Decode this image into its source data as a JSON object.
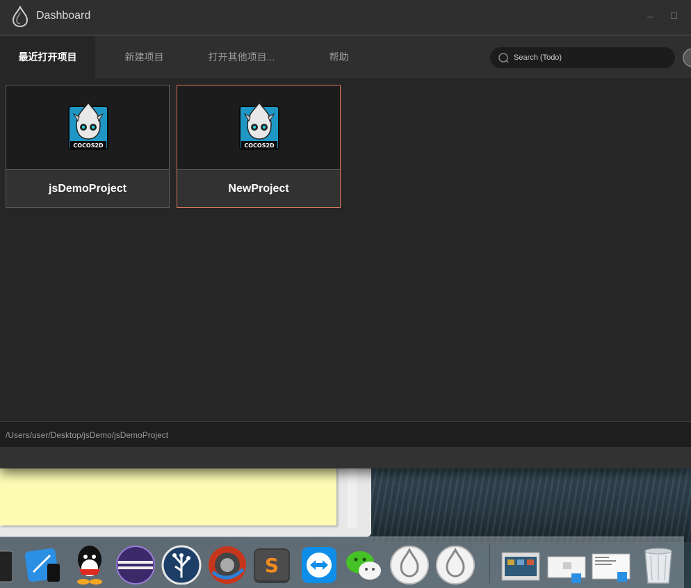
{
  "window": {
    "title": "Dashboard"
  },
  "tabs": [
    {
      "label": "最近打开项目",
      "active": true
    },
    {
      "label": "新建项目",
      "active": false
    },
    {
      "label": "打开其他项目...",
      "active": false
    },
    {
      "label": "帮助",
      "active": false
    }
  ],
  "search": {
    "placeholder": "Search (Todo)"
  },
  "projects": [
    {
      "name": "jsDemoProject",
      "selected": false
    },
    {
      "name": "NewProject",
      "selected": true
    }
  ],
  "status": {
    "path": "/Users/user/Desktop/jsDemo/jsDemoProject"
  },
  "logo": {
    "text": "COCOS2D"
  },
  "colors": {
    "accent_selected_border": "#d67a5c",
    "window_bg": "#262626",
    "titlebar_bg": "#2f2f2f"
  },
  "dock": {
    "items": [
      "window-fragment-icon",
      "xcode-icon",
      "qq-icon",
      "eclipse-icon",
      "sourcetree-icon",
      "screen-recorder-icon",
      "sublime-text-icon",
      "teamviewer-icon",
      "wechat-icon",
      "cocos-dashboard-icon",
      "cocos-dashboard-icon",
      "screenshot-thumb-icon",
      "screenshot-thumb-icon",
      "screenshot-thumb-icon",
      "trash-icon"
    ]
  }
}
